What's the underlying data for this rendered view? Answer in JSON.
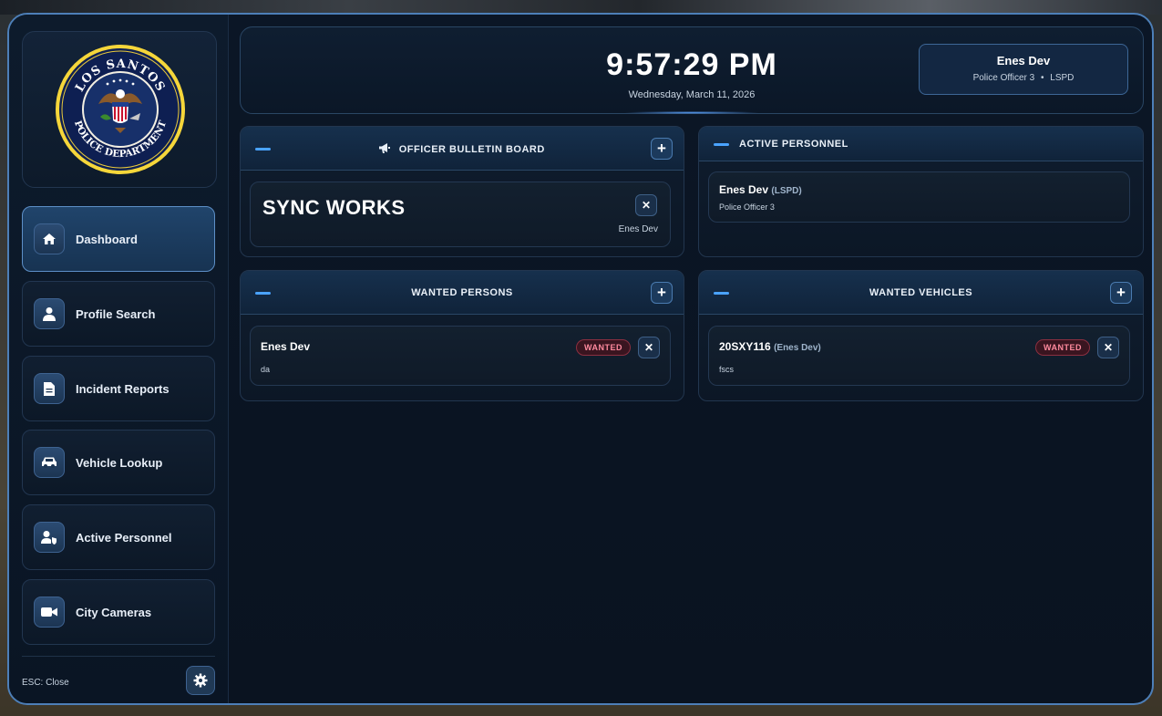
{
  "seal": {
    "top_text": "LOS SANTOS",
    "bottom_text": "POLICE DEPARTMENT"
  },
  "sidebar": {
    "items": [
      {
        "label": "Dashboard",
        "icon": "home-icon",
        "active": true
      },
      {
        "label": "Profile Search",
        "icon": "user-icon",
        "active": false
      },
      {
        "label": "Incident Reports",
        "icon": "document-icon",
        "active": false
      },
      {
        "label": "Vehicle Lookup",
        "icon": "car-icon",
        "active": false
      },
      {
        "label": "Active Personnel",
        "icon": "user-shield-icon",
        "active": false
      },
      {
        "label": "City Cameras",
        "icon": "video-camera-icon",
        "active": false
      }
    ],
    "footer": {
      "close_hint": "ESC: Close",
      "settings_icon": "gear-icon"
    }
  },
  "header": {
    "time": "9:57:29 PM",
    "date": "Wednesday, March 11, 2026",
    "user": {
      "name": "Enes Dev",
      "rank": "Police Officer 3",
      "department": "LSPD",
      "separator": "•"
    }
  },
  "bulletin": {
    "title": "OFFICER BULLETIN BOARD",
    "title_icon": "megaphone-icon",
    "add_label": "+",
    "posts": [
      {
        "text": "SYNC WORKS",
        "author": "Enes Dev",
        "close_label": "✕"
      }
    ]
  },
  "active_personnel": {
    "title": "ACTIVE PERSONNEL",
    "officers": [
      {
        "name": "Enes Dev",
        "dept": "(LSPD)",
        "rank": "Police Officer 3"
      }
    ]
  },
  "wanted_persons": {
    "title": "WANTED PERSONS",
    "add_label": "+",
    "entries": [
      {
        "name": "Enes Dev",
        "note": "da",
        "badge": "WANTED",
        "close_label": "✕"
      }
    ]
  },
  "wanted_vehicles": {
    "title": "WANTED VEHICLES",
    "add_label": "+",
    "entries": [
      {
        "plate": "20SXY116",
        "owner": "(Enes Dev)",
        "note": "fscs",
        "badge": "WANTED",
        "close_label": "✕"
      }
    ]
  },
  "colors": {
    "accent": "#4aa3ff",
    "border_active": "#5d8fc7",
    "wanted_badge": "#ff8a9e",
    "background": "#0a1320"
  }
}
